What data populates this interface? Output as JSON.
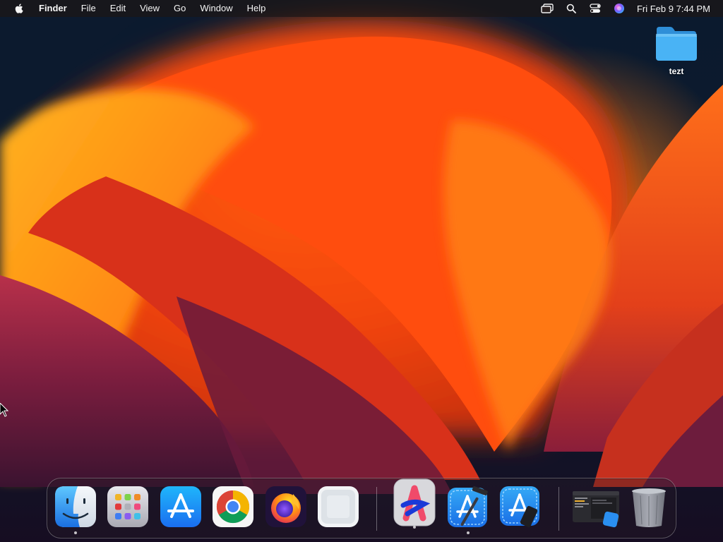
{
  "menubar": {
    "apple_menu": "apple-icon",
    "app_name": "Finder",
    "menus": [
      "File",
      "Edit",
      "View",
      "Go",
      "Window",
      "Help"
    ],
    "status_icons": [
      "screen-mirroring-icon",
      "spotlight-search-icon",
      "control-center-icon",
      "siri-icon"
    ],
    "clock": "Fri Feb 9  7:44 PM"
  },
  "desktop": {
    "items": [
      {
        "label": "tezt",
        "icon": "folder-icon",
        "color": "#3aa6f0"
      }
    ]
  },
  "dock": {
    "apps": [
      {
        "name": "Finder",
        "icon": "finder-icon",
        "running": true
      },
      {
        "name": "Launchpad",
        "icon": "launchpad-icon",
        "running": false
      },
      {
        "name": "App Store",
        "icon": "app-store-icon",
        "running": false
      },
      {
        "name": "Google Chrome",
        "icon": "chrome-icon",
        "running": false
      },
      {
        "name": "Firefox",
        "icon": "firefox-icon",
        "running": false
      },
      {
        "name": "Preview",
        "icon": "blank-app-icon",
        "running": false
      }
    ],
    "recent_apps": [
      {
        "name": "Accessibility Inspector",
        "icon": "accessibility-inspector-icon",
        "running": true
      },
      {
        "name": "Xcode",
        "icon": "xcode-icon",
        "running": true
      },
      {
        "name": "Simulator",
        "icon": "simulator-icon",
        "running": false
      }
    ],
    "others": [
      {
        "name": "Downloads",
        "icon": "window-thumbnail-icon"
      },
      {
        "name": "Trash",
        "icon": "trash-icon"
      }
    ]
  },
  "colors": {
    "accent_orange": "#ff7a10",
    "app_store_blue": "#1b8cf0",
    "folder_blue": "#3aa6f0"
  }
}
